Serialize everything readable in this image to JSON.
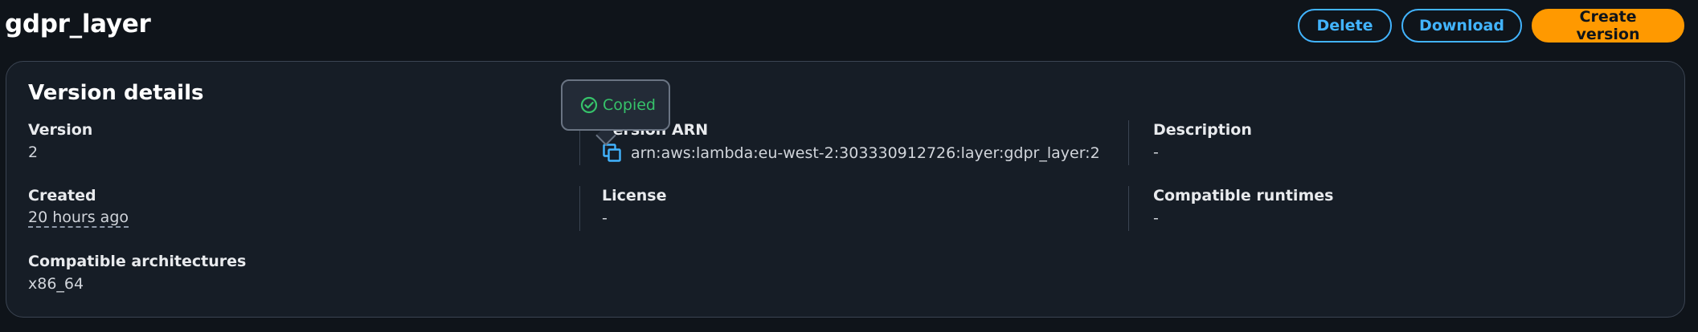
{
  "header": {
    "title": "gdpr_layer",
    "delete_label": "Delete",
    "download_label": "Download",
    "create_version_label": "Create version"
  },
  "details": {
    "title": "Version details",
    "version": {
      "label": "Version",
      "value": "2"
    },
    "version_arn": {
      "label": "Version ARN",
      "value": "arn:aws:lambda:eu-west-2:303330912726:layer:gdpr_layer:2"
    },
    "description": {
      "label": "Description",
      "value": "-"
    },
    "created": {
      "label": "Created",
      "value": "20 hours ago"
    },
    "license": {
      "label": "License",
      "value": "-"
    },
    "compatible_runtimes": {
      "label": "Compatible runtimes",
      "value": "-"
    },
    "compatible_architectures": {
      "label": "Compatible architectures",
      "value": "x86_64"
    }
  },
  "tooltip": {
    "text": "Copied"
  },
  "colors": {
    "background": "#0f141a",
    "card": "#161d26",
    "accent_blue": "#42b4ff",
    "primary_orange": "#ff9900",
    "success_green": "#36c26a"
  },
  "icons": {
    "copy": "copy-icon",
    "success": "check-circle-icon"
  }
}
